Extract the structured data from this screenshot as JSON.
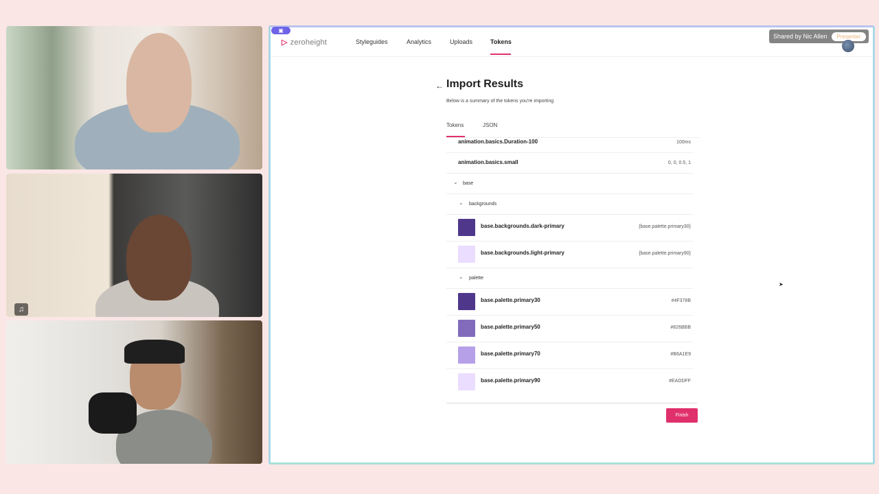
{
  "share": {
    "shared_by": "Shared by Nic Allen",
    "presenter_label": "Presenter"
  },
  "app": {
    "logo": "zeroheight",
    "nav": [
      "Styleguides",
      "Analytics",
      "Uploads",
      "Tokens"
    ],
    "active_nav": "Tokens"
  },
  "page": {
    "title": "Import Results",
    "subtitle": "Below is a summary of the tokens you're importing",
    "tabs": [
      "Tokens",
      "JSON"
    ],
    "active_tab": "Tokens",
    "finish_label": "Finish"
  },
  "tokens": {
    "top_rows": [
      {
        "name": "animation.basics.Duration-100",
        "value": "100ms"
      },
      {
        "name": "animation.basics.small",
        "value": "0, 0, 0.5, 1"
      }
    ],
    "group_base": "base",
    "group_backgrounds": "backgrounds",
    "backgrounds": [
      {
        "name": "base.backgrounds.dark-primary",
        "value": "{base.palette.primary30}",
        "color": "#4F378B"
      },
      {
        "name": "base.backgrounds.light-primary",
        "value": "{base.palette.primary90}",
        "color": "#EADDFF"
      }
    ],
    "group_palette": "palette",
    "palette": [
      {
        "name": "base.palette.primary30",
        "value": "#4F378B",
        "color": "#4F378B"
      },
      {
        "name": "base.palette.primary50",
        "value": "#826BBB",
        "color": "#826BBB"
      },
      {
        "name": "base.palette.primary70",
        "value": "#B6A1E9",
        "color": "#B6A1E9"
      },
      {
        "name": "base.palette.primary90",
        "value": "#EADDFF",
        "color": "#EADDFF"
      }
    ]
  },
  "colors": {
    "accent": "#e0306b",
    "background": "#fbe6e6"
  }
}
